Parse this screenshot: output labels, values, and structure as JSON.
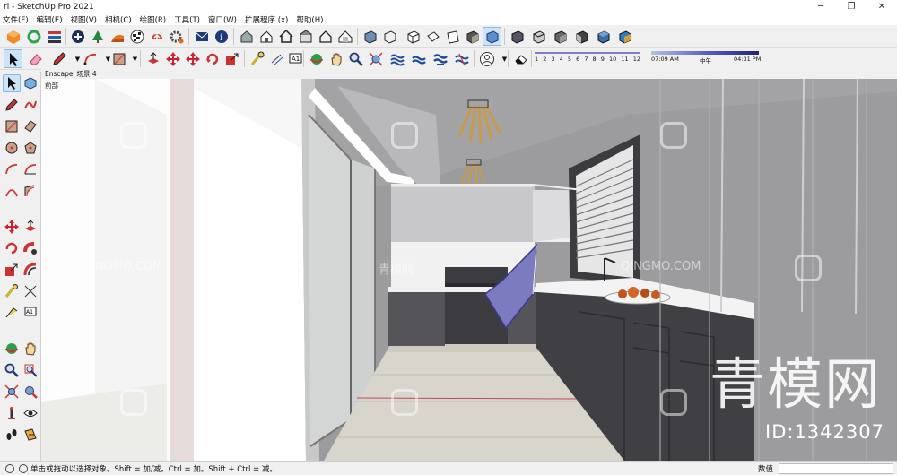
{
  "window": {
    "title": "ri - SketchUp Pro 2021",
    "minimize_icon": "minimize-icon",
    "maximize_icon": "restore-icon",
    "close_icon": "close-icon"
  },
  "menu": {
    "items": [
      {
        "label": "文件(F)"
      },
      {
        "label": "编辑(E)"
      },
      {
        "label": "视图(V)"
      },
      {
        "label": "相机(C)"
      },
      {
        "label": "绘图(R)"
      },
      {
        "label": "工具(T)"
      },
      {
        "label": "窗口(W)"
      },
      {
        "label": "扩展程序 (x)"
      },
      {
        "label": "帮助(H)"
      }
    ]
  },
  "toolbar_row1": {
    "icons": [
      "warehouse-3d-icon",
      "refresh-icon",
      "layers-icon",
      "add-location-icon",
      "tree-icon",
      "sandbox-icon",
      "checker-icon",
      "upload-icon",
      "gear-icon",
      "mail-icon",
      "info-icon",
      "model-info-icon",
      "house-icon",
      "home-icon",
      "building-icon",
      "house-outline-icon",
      "roof-icon",
      "cube-icon",
      "cube-outline-icon",
      "iso-view-icon",
      "top-view-icon",
      "front-view-icon",
      "right-view-icon",
      "back-view-icon",
      "left-view-icon",
      "xray-icon",
      "wireframe-icon",
      "hidden-line-icon",
      "shaded-icon",
      "textured-icon",
      "monochrome-icon"
    ]
  },
  "toolbar_row2": {
    "icons": [
      "select-icon",
      "eraser-icon",
      "pencil-icon",
      "arc-icon",
      "rectangle-icon",
      "push-pull-icon",
      "move-icon",
      "rotate-icon",
      "scale-icon",
      "tape-measure-icon",
      "text-icon",
      "orbit-icon",
      "pan-icon",
      "zoom-icon",
      "zoom-extents-icon",
      "section-icon",
      "sandbox-smoove-icon",
      "stamp-icon",
      "drape-icon",
      "profile-icon",
      "eraser2-icon"
    ]
  },
  "shadow": {
    "months": [
      "1",
      "2",
      "3",
      "4",
      "5",
      "6",
      "7",
      "8",
      "9",
      "10",
      "11",
      "12"
    ],
    "time_start": "07:09 AM",
    "time_mid": "中午",
    "time_end": "04:31 PM"
  },
  "palette": {
    "icons": [
      "select-icon",
      "component-icon",
      "pencil-icon",
      "freehand-icon",
      "rectangle-icon",
      "rotated-rect-icon",
      "circle-icon",
      "polygon-icon",
      "arc-icon",
      "pie-icon",
      "two-point-arc-icon",
      "three-point-arc-icon",
      "move-icon",
      "push-pull-icon",
      "rotate-icon",
      "follow-me-icon",
      "scale-icon",
      "offset-icon",
      "tape-measure-icon",
      "dimension-icon",
      "protractor-icon",
      "text-icon",
      "axes-icon",
      "3d-text-icon",
      "orbit-icon",
      "pan-icon",
      "zoom-icon",
      "zoom-window-icon",
      "zoom-extents-icon",
      "previous-view-icon",
      "position-camera-icon",
      "look-around-icon",
      "walk-icon",
      "section-plane-icon"
    ]
  },
  "scene": {
    "tab1": "Enscape",
    "tab2": "场景 4",
    "label": "前部"
  },
  "watermark": {
    "brand": "QINGMO.COM",
    "brand_cn": "青模网",
    "big_text": "青模网",
    "id_text": "ID:1342307"
  },
  "status": {
    "hint": "单击或拖动以选择对象。Shift = 加/减。Ctrl = 加。Shift + Ctrl = 减。",
    "vcb_label": "数值",
    "vcb_value": ""
  }
}
